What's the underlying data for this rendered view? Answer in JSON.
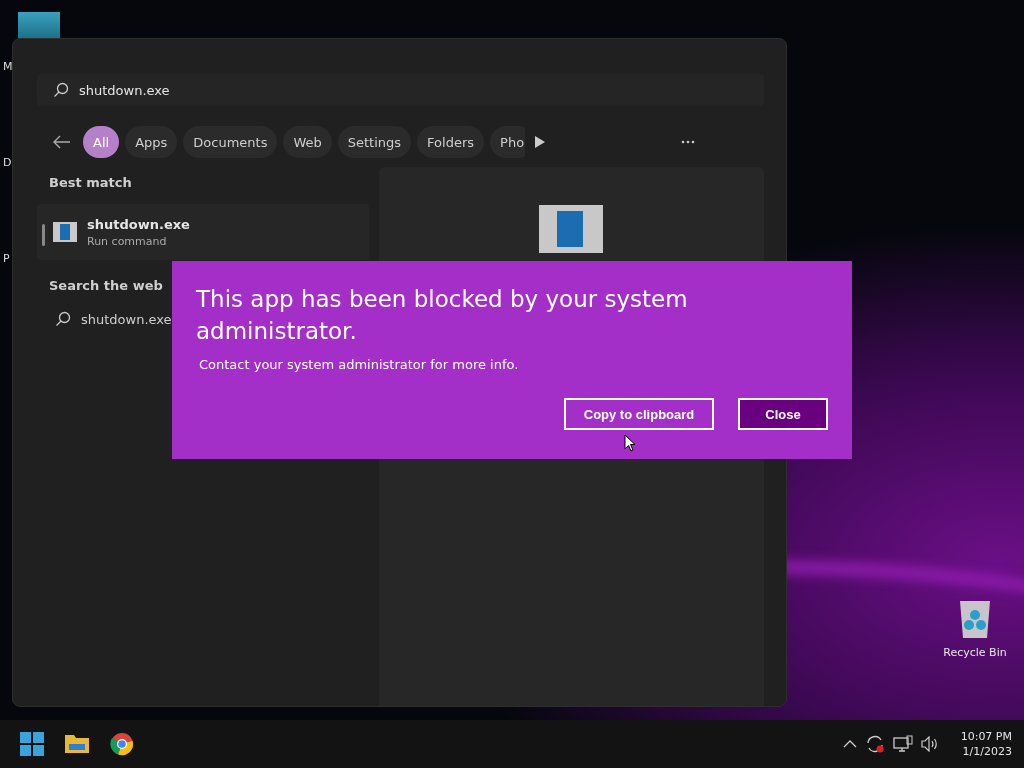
{
  "desktop": {
    "icons": [
      {
        "label": "M"
      },
      {
        "label": "D"
      },
      {
        "label": "P"
      }
    ],
    "recycle_bin": {
      "label": "Recycle Bin"
    }
  },
  "search": {
    "query": "shutdown.exe",
    "filters": [
      {
        "label": "All",
        "selected": true
      },
      {
        "label": "Apps",
        "selected": false
      },
      {
        "label": "Documents",
        "selected": false
      },
      {
        "label": "Web",
        "selected": false
      },
      {
        "label": "Settings",
        "selected": false
      },
      {
        "label": "Folders",
        "selected": false
      },
      {
        "label": "Pho",
        "selected": false
      }
    ],
    "best_match": {
      "heading": "Best match",
      "title": "shutdown.exe",
      "subtitle": "Run command"
    },
    "web": {
      "heading": "Search the web",
      "query": "shutdown.exe"
    }
  },
  "dialog": {
    "title": "This app has been blocked by your system administrator.",
    "message": "Contact your system administrator for more info.",
    "buttons": [
      {
        "label": "Copy to clipboard",
        "kind": "secondary"
      },
      {
        "label": "Close",
        "kind": "primary"
      }
    ]
  },
  "taskbar": {
    "time": "10:07 PM",
    "date": "1/1/2023"
  }
}
